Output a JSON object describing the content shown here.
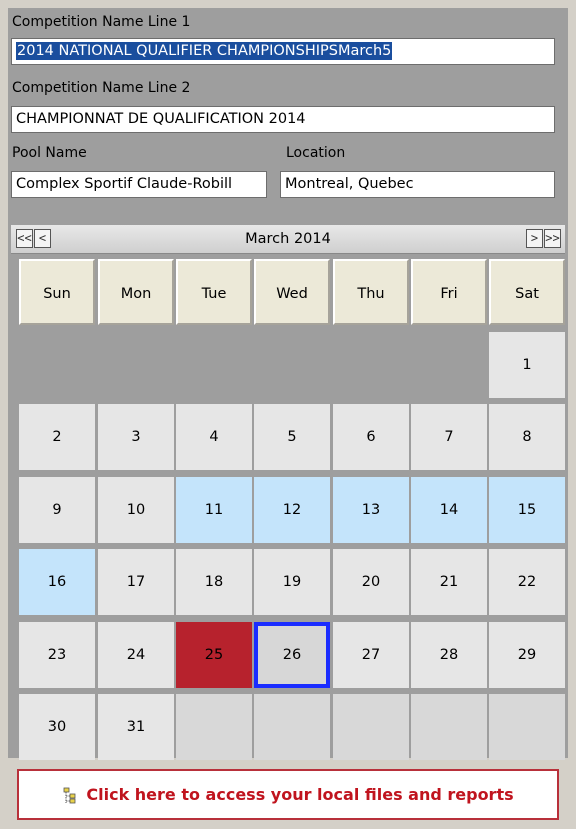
{
  "fields": {
    "name1": {
      "label": "Competition Name Line 1",
      "value": "2014 NATIONAL QUALIFIER CHAMPIONSHIPSMarch5"
    },
    "name2": {
      "label": "Competition Name Line 2",
      "value": "CHAMPIONNAT DE QUALIFICATION 2014"
    },
    "pool": {
      "label": "Pool Name",
      "value": "Complex Sportif Claude-Robill"
    },
    "location": {
      "label": "Location",
      "value": "Montreal, Quebec"
    }
  },
  "calendar": {
    "month_label": "March 2014",
    "nav": {
      "prev_year": "<<",
      "prev": "<",
      "next": ">",
      "next_year": ">>"
    },
    "weekdays": [
      "Sun",
      "Mon",
      "Tue",
      "Wed",
      "Thu",
      "Fri",
      "Sat"
    ],
    "highlighted_days": [
      11,
      12,
      13,
      14,
      15,
      16
    ],
    "red_day": 25,
    "selected_day": 26,
    "first_weekday": 6,
    "days_in_month": 31
  },
  "footer": {
    "label": "Click here to access your local files and reports",
    "icon": "tree-files-icon"
  },
  "colors": {
    "panel": "#9e9e9e",
    "highlight": "#c4e4fb",
    "red": "#b7222d",
    "selected_border": "#1a2cff",
    "footer_text": "#c0141e"
  }
}
